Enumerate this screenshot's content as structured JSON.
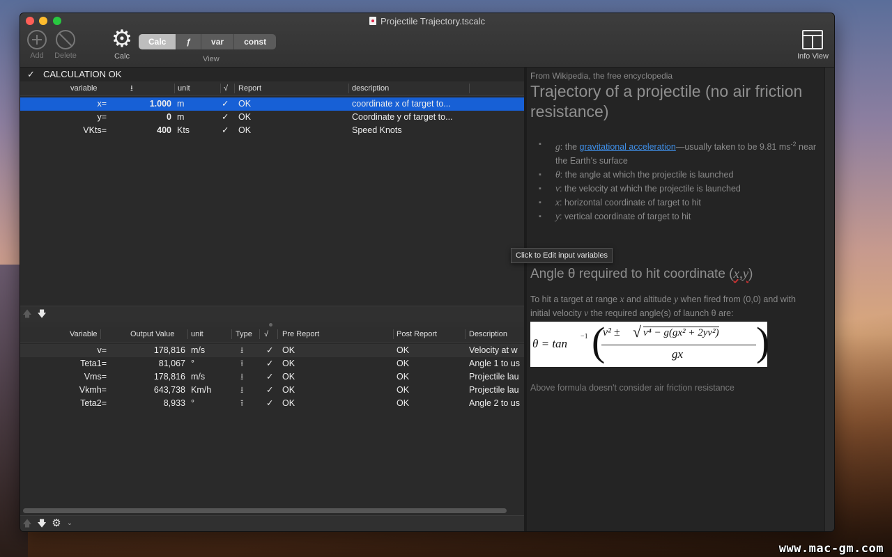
{
  "window": {
    "title": "Projectile Trajectory.tscalc"
  },
  "toolbar": {
    "add_label": "Add",
    "delete_label": "Delete",
    "calc_label": "Calc",
    "segments": [
      "Calc",
      "ƒ",
      "var",
      "const"
    ],
    "selected_segment": "Calc",
    "view_label": "View",
    "info_view_label": "Info View"
  },
  "status": {
    "check": "✓",
    "text": "CALCULATION OK"
  },
  "inputs": {
    "headers": {
      "variable": "variable",
      "icon": "⭳",
      "unit": "unit",
      "check": "√",
      "report": "Report",
      "description": "description"
    },
    "rows": [
      {
        "name": "x=",
        "value": "1.000",
        "unit": "m",
        "check": "✓",
        "report": "OK",
        "description": "coordinate x of target to..."
      },
      {
        "name": "y=",
        "value": "0",
        "unit": "m",
        "check": "✓",
        "report": "OK",
        "description": "Coordinate y of target to..."
      },
      {
        "name": "VKts=",
        "value": "400",
        "unit": "Kts",
        "check": "✓",
        "report": "OK",
        "description": "Speed Knots"
      }
    ]
  },
  "outputs": {
    "headers": {
      "variable": "Variable",
      "value": "Output Value",
      "unit": "unit",
      "type": "Type",
      "check": "√",
      "pre": "Pre Report",
      "post": "Post Report",
      "description": "Description"
    },
    "rows": [
      {
        "name": "v=",
        "value": "178,816",
        "unit": "m/s",
        "type": "⭳",
        "check": "✓",
        "pre": "OK",
        "post": "OK",
        "description": "Velocity at w"
      },
      {
        "name": "Teta1=",
        "value": "81,067",
        "unit": "°",
        "type": "⭱",
        "check": "✓",
        "pre": "OK",
        "post": "OK",
        "description": "Angle 1 to us"
      },
      {
        "name": "Vms=",
        "value": "178,816",
        "unit": "m/s",
        "type": "⭳",
        "check": "✓",
        "pre": "OK",
        "post": "OK",
        "description": "Projectile lau"
      },
      {
        "name": "Vkmh=",
        "value": "643,738",
        "unit": "Km/h",
        "type": "⭳",
        "check": "✓",
        "pre": "OK",
        "post": "OK",
        "description": "Projectile lau"
      },
      {
        "name": "Teta2=",
        "value": "8,933",
        "unit": "°",
        "type": "⭱",
        "check": "✓",
        "pre": "OK",
        "post": "OK",
        "description": "Angle 2 to us"
      }
    ]
  },
  "info": {
    "source": "From Wikipedia, the free encyclopedia",
    "title": "Trajectory of a projectile (no air friction resistance)",
    "bullets": [
      {
        "var": "g",
        "pre": ": the ",
        "link": "gravitational acceleration",
        "post": "—usually taken to be 9.81 ms",
        "sup": "-2",
        "tail": " near the Earth's surface"
      },
      {
        "var": "θ",
        "text": ": the angle at which the projectile is launched"
      },
      {
        "var": "v",
        "text": ": the velocity at which the projectile is launched"
      },
      {
        "var": "x",
        "text": ": horizontal coordinate of target to hit"
      },
      {
        "var": "y",
        "text": ": vertical coordinate of target to hit"
      }
    ],
    "heading2": "Angle θ required to hit coordinate (",
    "heading2_xy": "x,y",
    "heading2_end": ")",
    "para_1": "To hit a target at range ",
    "para_x": "x",
    "para_2": " and altitude ",
    "para_y": "y",
    "para_3": " when fired from (0,0) and with initial velocity ",
    "para_v": "v",
    "para_4": " the required angle(s) of launch θ are:",
    "formula": {
      "lhs": "θ = tan",
      "lhs_sup": "−1",
      "numerator_a": "v² ± ",
      "numerator_root": "v⁴ − g(gx² + 2yv²)",
      "denominator": "gx"
    },
    "note": "Above formula doesn't consider air friction resistance"
  },
  "tooltip": "Click to Edit input variables",
  "watermark": "www.mac-gm.com",
  "colors": {
    "selection": "#1760d6",
    "link": "#3f8fe8",
    "close": "#ff5f57",
    "minimize": "#febc2e",
    "maximize": "#28c840"
  }
}
